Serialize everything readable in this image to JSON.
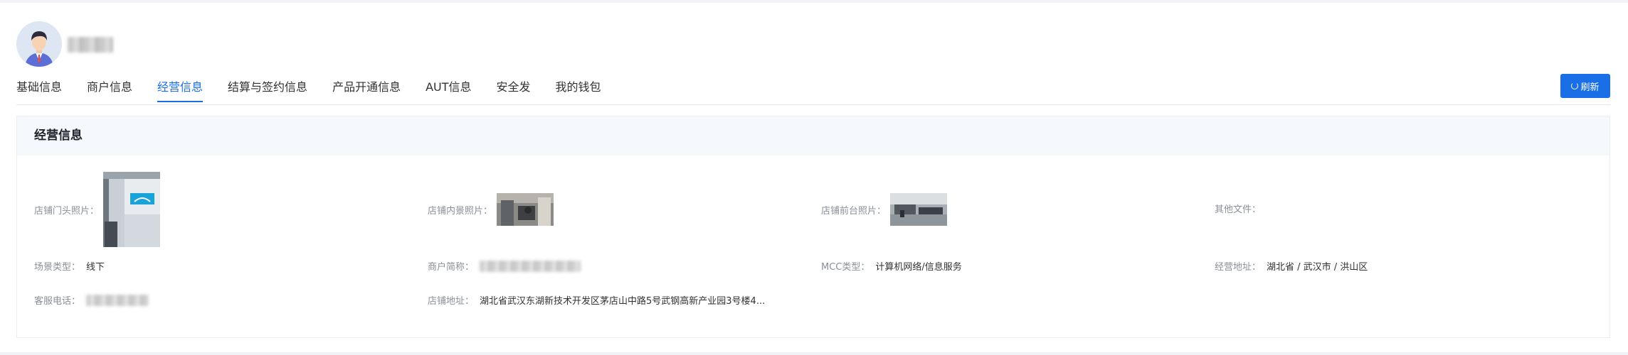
{
  "header": {
    "avatar_icon": "user-avatar-icon",
    "username": ""
  },
  "tabs": [
    {
      "label": "基础信息",
      "active": false
    },
    {
      "label": "商户信息",
      "active": false
    },
    {
      "label": "经营信息",
      "active": true
    },
    {
      "label": "结算与签约信息",
      "active": false
    },
    {
      "label": "产品开通信息",
      "active": false
    },
    {
      "label": "AUT信息",
      "active": false
    },
    {
      "label": "安全发",
      "active": false
    },
    {
      "label": "我的钱包",
      "active": false
    }
  ],
  "toolbar": {
    "refresh_label": "刷新",
    "refresh_icon": "refresh-icon"
  },
  "section": {
    "title": "经营信息",
    "fields": {
      "storefront_photo": {
        "label": "店铺门头照片："
      },
      "interior_photo": {
        "label": "店铺内景照片："
      },
      "front_desk_photo": {
        "label": "店铺前台照片："
      },
      "other_files": {
        "label": "其他文件：",
        "value": ""
      },
      "scene_type": {
        "label": "场景类型：",
        "value": "线下"
      },
      "merchant_short_name": {
        "label": "商户简称：",
        "value": ""
      },
      "mcc_type": {
        "label": "MCC类型：",
        "value": "计算机网络/信息服务"
      },
      "business_address": {
        "label": "经营地址：",
        "value": "湖北省 / 武汉市 / 洪山区"
      },
      "service_phone": {
        "label": "客服电话：",
        "value": ""
      },
      "store_address": {
        "label": "店铺地址：",
        "value": "湖北省武汉东湖新技术开发区茅店山中路5号武钢高新产业园3号楼4..."
      }
    }
  },
  "colors": {
    "accent": "#1a6fe6",
    "label": "#8a8f99",
    "section_header_bg": "#f5f8fd"
  }
}
